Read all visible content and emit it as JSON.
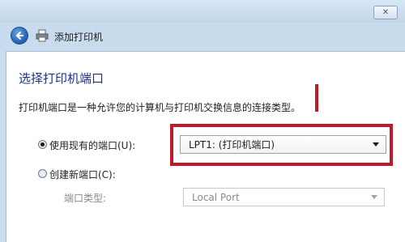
{
  "window": {
    "close_label": "✕"
  },
  "header": {
    "title": "添加打印机"
  },
  "page": {
    "title": "选择打印机端口",
    "description": "打印机端口是一种允许您的计算机与打印机交换信息的连接类型。"
  },
  "options": {
    "use_existing_label": "使用现有的端口(U):",
    "use_existing_selected": true,
    "existing_port_value": "LPT1: (打印机端口)",
    "create_new_label": "创建新端口(C):",
    "create_new_selected": false,
    "port_type_label": "端口类型:",
    "port_type_value": "Local Port"
  },
  "colors": {
    "highlight": "#c0192b",
    "title": "#1e3287"
  }
}
